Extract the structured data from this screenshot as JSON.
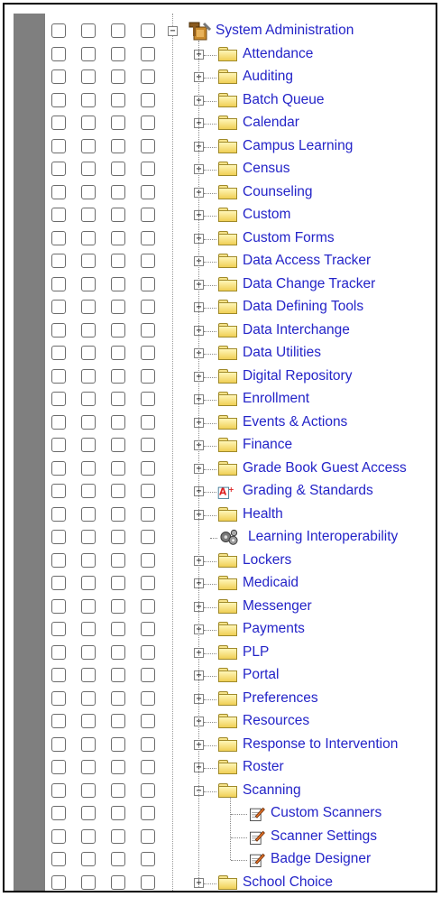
{
  "root": {
    "label": "System Administration",
    "expanded": true,
    "icon": "admin-tools-icon"
  },
  "tree": [
    {
      "label": "Attendance",
      "icon": "folder-icon",
      "expander": "+"
    },
    {
      "label": "Auditing",
      "icon": "folder-icon",
      "expander": "+"
    },
    {
      "label": "Batch Queue",
      "icon": "folder-icon",
      "expander": "+"
    },
    {
      "label": "Calendar",
      "icon": "folder-icon",
      "expander": "+"
    },
    {
      "label": "Campus Learning",
      "icon": "folder-icon",
      "expander": "+"
    },
    {
      "label": "Census",
      "icon": "folder-icon",
      "expander": "+"
    },
    {
      "label": "Counseling",
      "icon": "folder-icon",
      "expander": "+"
    },
    {
      "label": "Custom",
      "icon": "folder-icon",
      "expander": "+"
    },
    {
      "label": "Custom Forms",
      "icon": "folder-icon",
      "expander": "+"
    },
    {
      "label": "Data Access Tracker",
      "icon": "folder-icon",
      "expander": "+"
    },
    {
      "label": "Data Change Tracker",
      "icon": "folder-icon",
      "expander": "+"
    },
    {
      "label": "Data Defining Tools",
      "icon": "folder-icon",
      "expander": "+"
    },
    {
      "label": "Data Interchange",
      "icon": "folder-icon",
      "expander": "+"
    },
    {
      "label": "Data Utilities",
      "icon": "folder-icon",
      "expander": "+"
    },
    {
      "label": "Digital Repository",
      "icon": "folder-icon",
      "expander": "+"
    },
    {
      "label": "Enrollment",
      "icon": "folder-icon",
      "expander": "+"
    },
    {
      "label": "Events & Actions",
      "icon": "folder-icon",
      "expander": "+"
    },
    {
      "label": "Finance",
      "icon": "folder-icon",
      "expander": "+"
    },
    {
      "label": "Grade Book Guest Access",
      "icon": "folder-icon",
      "expander": "+"
    },
    {
      "label": "Grading & Standards",
      "icon": "grading-a-plus-icon",
      "expander": "+"
    },
    {
      "label": "Health",
      "icon": "folder-icon",
      "expander": "+"
    },
    {
      "label": "Learning Interoperability",
      "icon": "gears-icon",
      "expander": ""
    },
    {
      "label": "Lockers",
      "icon": "folder-icon",
      "expander": "+"
    },
    {
      "label": "Medicaid",
      "icon": "folder-icon",
      "expander": "+"
    },
    {
      "label": "Messenger",
      "icon": "folder-icon",
      "expander": "+"
    },
    {
      "label": "Payments",
      "icon": "folder-icon",
      "expander": "+"
    },
    {
      "label": "PLP",
      "icon": "folder-icon",
      "expander": "+"
    },
    {
      "label": "Portal",
      "icon": "folder-icon",
      "expander": "+"
    },
    {
      "label": "Preferences",
      "icon": "folder-icon",
      "expander": "+"
    },
    {
      "label": "Resources",
      "icon": "folder-icon",
      "expander": "+"
    },
    {
      "label": "Response to Intervention",
      "icon": "folder-icon",
      "expander": "+"
    },
    {
      "label": "Roster",
      "icon": "folder-icon",
      "expander": "+"
    },
    {
      "label": "Scanning",
      "icon": "folder-icon",
      "expander": "-"
    },
    {
      "label": "Custom Scanners",
      "icon": "notepad-pencil-icon",
      "expander": "",
      "child": true
    },
    {
      "label": "Scanner Settings",
      "icon": "notepad-pencil-icon",
      "expander": "",
      "child": true
    },
    {
      "label": "Badge Designer",
      "icon": "notepad-pencil-icon",
      "expander": "",
      "child": true
    },
    {
      "label": "School Choice",
      "icon": "folder-icon",
      "expander": "+"
    }
  ],
  "colors": {
    "link": "#2424c8",
    "gutter": "#7f7f7f"
  }
}
